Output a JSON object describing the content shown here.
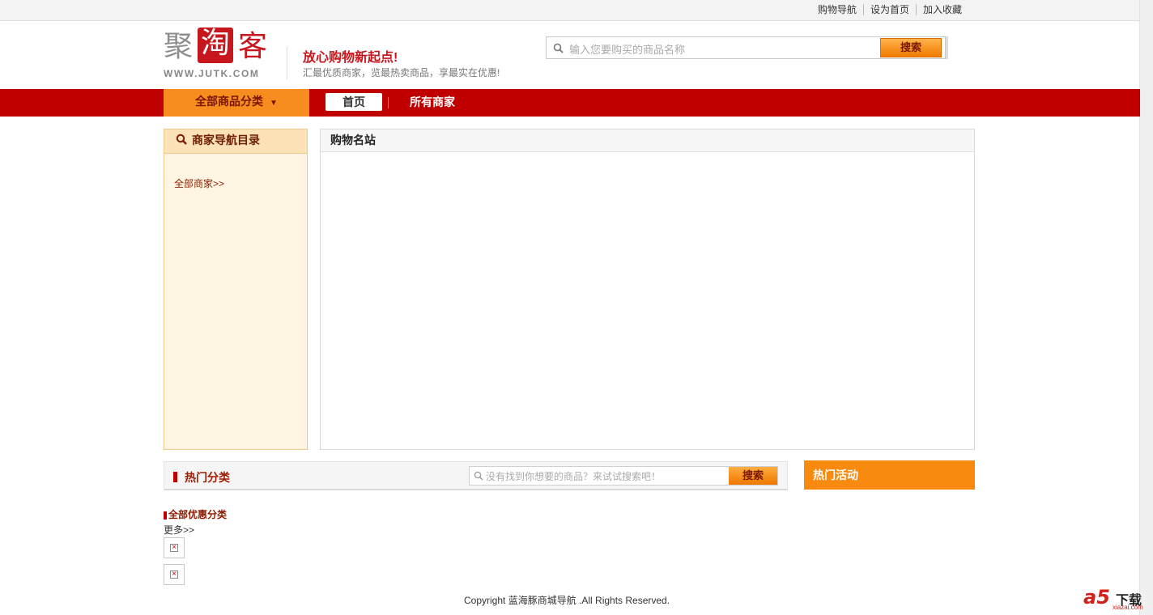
{
  "topbar": {
    "links": [
      "购物导航",
      "设为首页",
      "加入收藏"
    ]
  },
  "header": {
    "logo": {
      "chars": [
        "聚",
        "淘",
        "客"
      ],
      "domain": "WWW.JUTK.COM"
    },
    "slogan": "放心购物新起点!",
    "subslogan": "汇最优质商家，览最热卖商品，享最实在优惠!",
    "search": {
      "placeholder": "输入您要购买的商品名称",
      "button": "搜索"
    }
  },
  "nav": {
    "all_categories": "全部商品分类",
    "items": [
      "首页",
      "所有商家"
    ]
  },
  "sidebar": {
    "title": "商家导航目录",
    "link": "全部商家>>"
  },
  "main": {
    "title": "购物名站"
  },
  "hot": {
    "title": "热门分类",
    "search_placeholder": "没有找到你想要的商品？来试试搜索吧！",
    "search_button": "搜索",
    "activity_title": "热门活动",
    "discount_label": "全部优惠分类",
    "more": "更多>>"
  },
  "footer": {
    "copyright": "Copyright 蓝海豚商城导航  .All Rights Reserved."
  },
  "watermark": {
    "brand": "a5",
    "label": "下载",
    "url": "xiazai.com"
  },
  "colors": {
    "nav_red": "#c00000",
    "accent_orange": "#f78d1e",
    "logo_red": "#c8161e"
  }
}
